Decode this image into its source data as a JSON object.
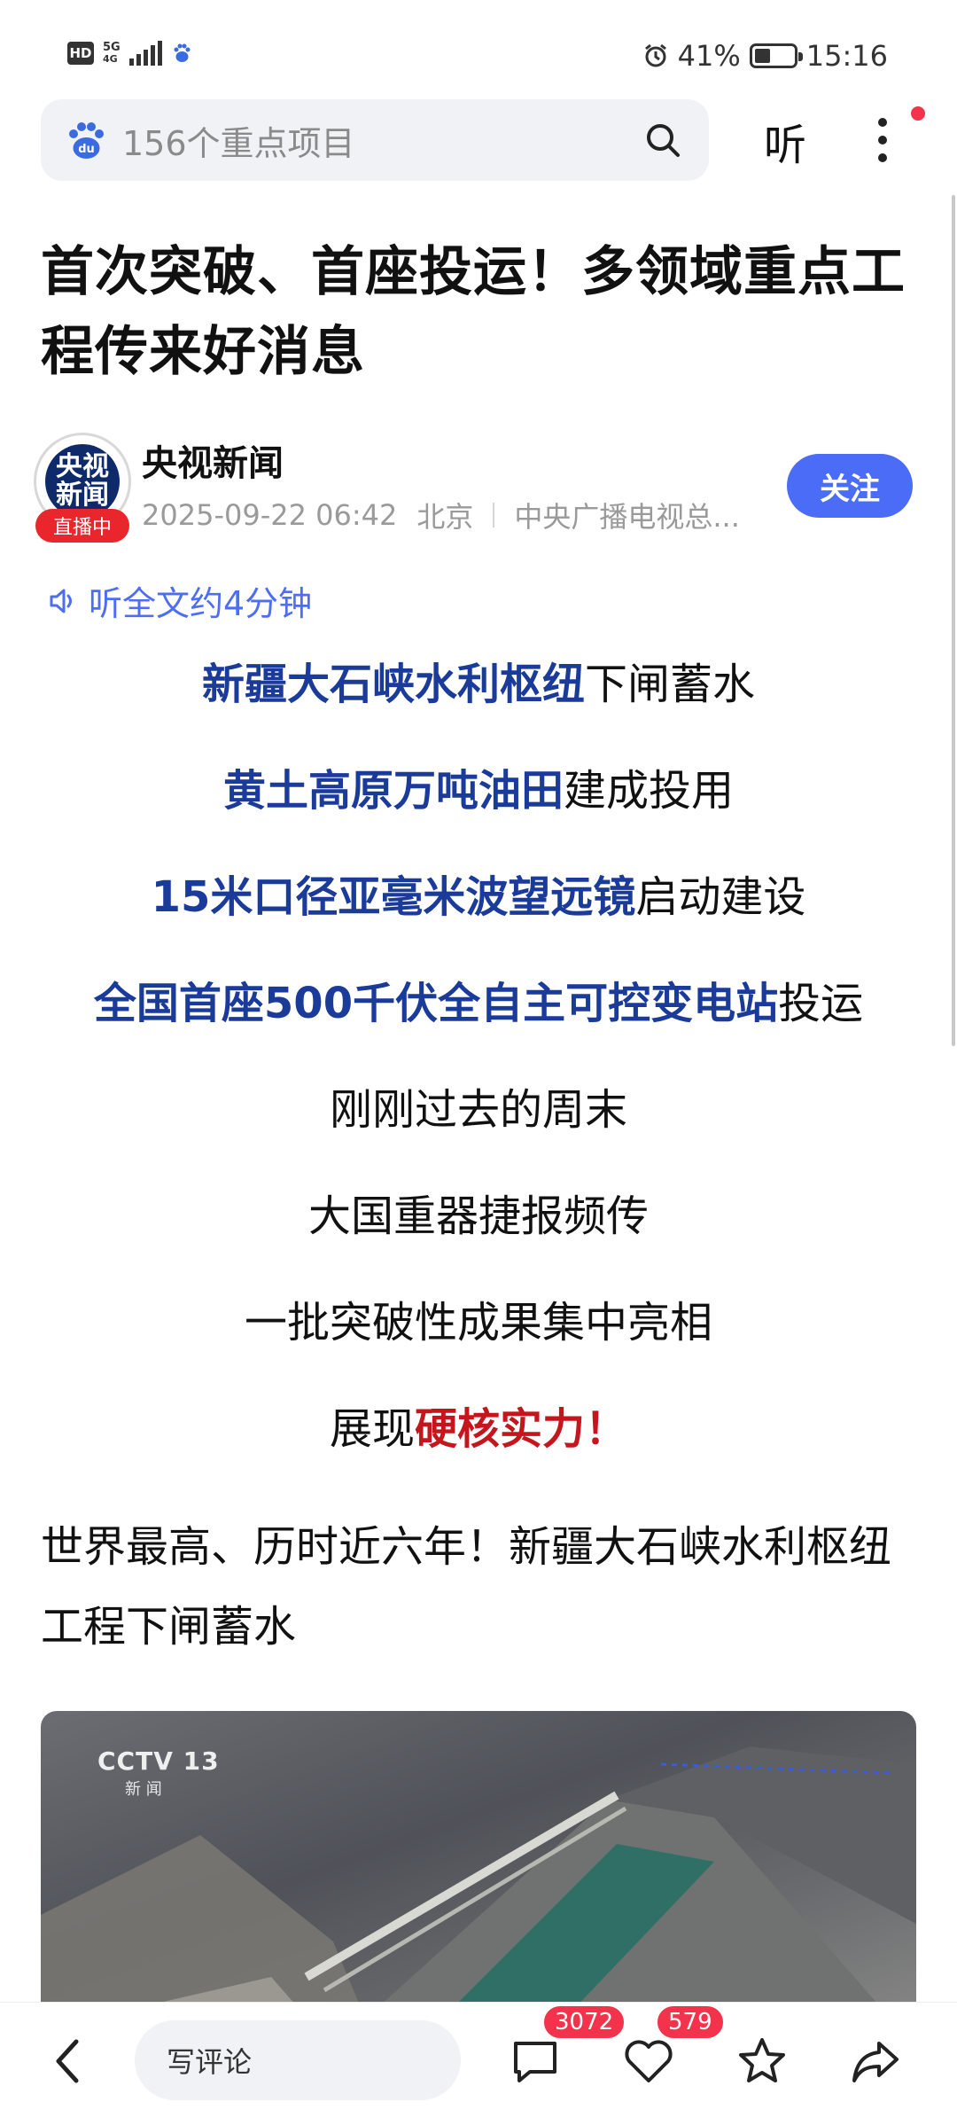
{
  "status_bar": {
    "hd": "HD",
    "network": "5G",
    "network_sub": "4G",
    "battery_text": "41%",
    "battery_level": 0.41,
    "time": "15:16"
  },
  "search": {
    "text": "156个重点项目"
  },
  "top_actions": {
    "listen": "听"
  },
  "article": {
    "title": "首次突破、首座投运！多领域重点工程传来好消息",
    "author": {
      "avatar_line1": "央视",
      "avatar_line2": "新闻",
      "live_badge": "直播中",
      "name": "央视新闻",
      "date": "2025-09-22 06:42",
      "location": "北京",
      "source": "中央广播电视总...",
      "follow": "关注"
    },
    "listen_full": "听全文约4分钟",
    "highlights": [
      {
        "em": "新疆大石峡水利枢纽",
        "rest": "下闸蓄水"
      },
      {
        "em": "黄土高原万吨油田",
        "rest": "建成投用"
      },
      {
        "em": "15米口径亚毫米波望远镜",
        "rest": "启动建设"
      },
      {
        "em": "全国首座500千伏全自主可控变电站",
        "rest": "投运"
      }
    ],
    "lines": [
      "刚刚过去的周末",
      "大国重器捷报频传",
      "一批突破性成果集中亮相"
    ],
    "showcase": {
      "plain": "展现",
      "em": "硬核实力！"
    },
    "paragraph": "世界最高、历时近六年！新疆大石峡水利枢纽工程下闸蓄水",
    "video": {
      "logo": "CCTV 13",
      "sub": "新 闻"
    }
  },
  "bottom_bar": {
    "comment_placeholder": "写评论",
    "comments": "3072",
    "likes": "579"
  }
}
